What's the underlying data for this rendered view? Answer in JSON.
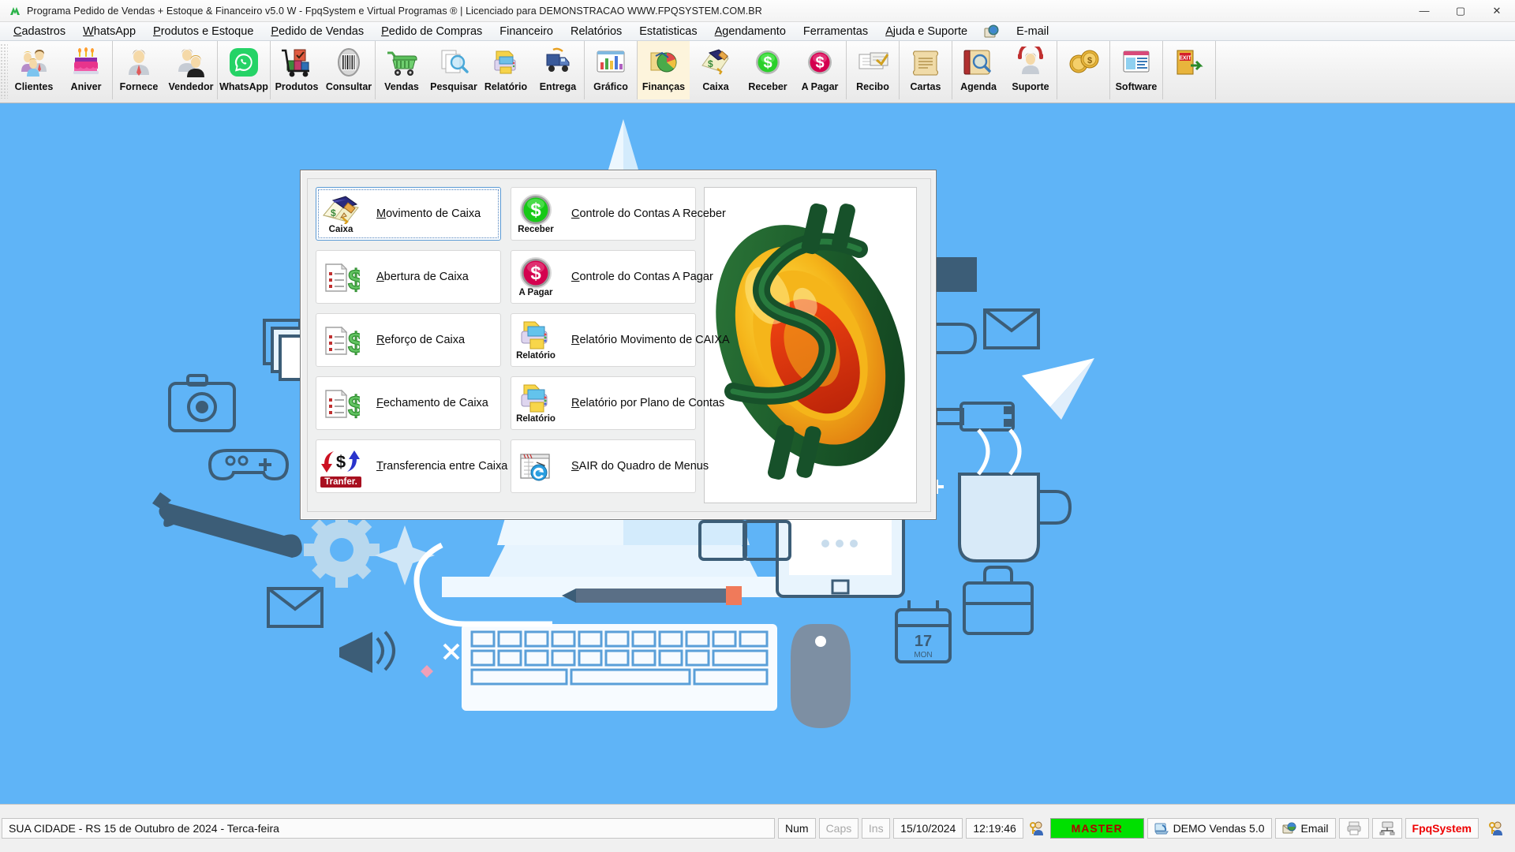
{
  "window": {
    "title": "Programa Pedido de Vendas + Estoque & Financeiro v5.0 W - FpqSystem e Virtual Programas ® | Licenciado para  DEMONSTRACAO WWW.FPQSYSTEM.COM.BR",
    "app_icon": "app-logo-icon",
    "minimize": "—",
    "maximize": "▢",
    "close": "✕"
  },
  "menubar": {
    "items": [
      {
        "label": "Cadastros",
        "accel": "C"
      },
      {
        "label": "WhatsApp",
        "accel": "W"
      },
      {
        "label": "Produtos e Estoque",
        "accel": "P"
      },
      {
        "label": "Pedido de Vendas",
        "accel": "P"
      },
      {
        "label": "Pedido de Compras",
        "accel": "P"
      },
      {
        "label": "Financeiro",
        "accel": ""
      },
      {
        "label": "Relatórios",
        "accel": ""
      },
      {
        "label": "Estatisticas",
        "accel": ""
      },
      {
        "label": "Agendamento",
        "accel": "A"
      },
      {
        "label": "Ferramentas",
        "accel": ""
      },
      {
        "label": "Ajuda e Suporte",
        "accel": "A"
      },
      {
        "label": "E-mail",
        "accel": ""
      }
    ],
    "globe_icon": "globe-icon"
  },
  "toolbar": {
    "groups": [
      {
        "buttons": [
          {
            "label": "Clientes",
            "icon": "clients-icon"
          },
          {
            "label": "Aniver",
            "icon": "birthday-cake-icon"
          }
        ]
      },
      {
        "buttons": [
          {
            "label": "Fornece",
            "icon": "supplier-person-icon"
          },
          {
            "label": "Vendedor",
            "icon": "salesperson-icon"
          }
        ]
      },
      {
        "buttons": [
          {
            "label": "WhatsApp",
            "icon": "whatsapp-icon"
          }
        ]
      },
      {
        "buttons": [
          {
            "label": "Produtos",
            "icon": "products-cart-icon"
          },
          {
            "label": "Consultar",
            "icon": "barcode-icon"
          }
        ]
      },
      {
        "buttons": [
          {
            "label": "Vendas",
            "icon": "shopping-cart-icon"
          },
          {
            "label": "Pesquisar",
            "icon": "search-documents-icon"
          },
          {
            "label": "Relatório",
            "icon": "report-printer-icon"
          },
          {
            "label": "Entrega",
            "icon": "delivery-truck-icon"
          }
        ]
      },
      {
        "buttons": [
          {
            "label": "Gráfico",
            "icon": "bar-chart-icon"
          }
        ]
      },
      {
        "buttons": [
          {
            "label": "Finanças",
            "icon": "finance-pie-icon",
            "selected": true
          },
          {
            "label": "Caixa",
            "icon": "cash-book-icon"
          },
          {
            "label": "Receber",
            "icon": "receive-money-icon"
          },
          {
            "label": "A Pagar",
            "icon": "pay-money-icon"
          }
        ]
      },
      {
        "buttons": [
          {
            "label": "Recibo",
            "icon": "receipt-icon"
          }
        ]
      },
      {
        "buttons": [
          {
            "label": "Cartas",
            "icon": "letters-scroll-icon"
          }
        ]
      },
      {
        "buttons": [
          {
            "label": "Agenda",
            "icon": "agenda-search-icon"
          },
          {
            "label": "Suporte",
            "icon": "support-person-icon"
          }
        ]
      },
      {
        "buttons": [
          {
            "label": "",
            "icon": "money-coins-icon"
          }
        ]
      },
      {
        "buttons": [
          {
            "label": "Software",
            "icon": "software-window-icon"
          }
        ]
      },
      {
        "buttons": [
          {
            "label": "",
            "icon": "exit-door-icon"
          }
        ]
      }
    ]
  },
  "dialog": {
    "left_buttons": [
      {
        "label": "Movimento de Caixa",
        "accel": "M",
        "sub": "Caixa",
        "icon": "cash-book-icon",
        "focused": true
      },
      {
        "label": "Abertura de Caixa",
        "accel": "A",
        "sub": "",
        "icon": "open-cash-icon",
        "focused": false
      },
      {
        "label": "Reforço de Caixa",
        "accel": "R",
        "sub": "",
        "icon": "reinforce-cash-icon",
        "focused": false
      },
      {
        "label": "Fechamento de Caixa",
        "accel": "F",
        "sub": "",
        "icon": "close-cash-icon",
        "focused": false
      },
      {
        "label": "Transferencia entre Caixa",
        "accel": "T",
        "sub": "Tranfer.",
        "icon": "transfer-icon",
        "focused": false
      }
    ],
    "right_buttons": [
      {
        "label": "Controle do Contas A Receber",
        "accel": "C",
        "sub": "Receber",
        "icon": "receive-money-icon",
        "focused": false
      },
      {
        "label": "Controle do Contas A Pagar",
        "accel": "C",
        "sub": "A Pagar",
        "icon": "pay-money-icon",
        "focused": false
      },
      {
        "label": "Relatório Movimento de CAIXA",
        "accel": "R",
        "sub": "Relatório",
        "icon": "report-printer-icon",
        "focused": false
      },
      {
        "label": "Relatório por Plano de Contas",
        "accel": "R",
        "sub": "Relatório",
        "icon": "report-printer-icon",
        "focused": false
      },
      {
        "label": "SAIR do Quadro de Menus",
        "accel": "S",
        "sub": "",
        "icon": "exit-back-icon",
        "focused": false
      }
    ],
    "artwork": "dollar-sign-sphere-graphic"
  },
  "statusbar": {
    "message": "SUA CIDADE - RS 15 de Outubro de 2024 - Terca-feira",
    "num": "Num",
    "caps": "Caps",
    "ins": "Ins",
    "date": "15/10/2024",
    "time": "12:19:46",
    "user_icon": "user-key-icon",
    "user_level": "MASTER",
    "version_icon": "computer-icon",
    "version": "DEMO Vendas 5.0",
    "email_icon": "email-globe-icon",
    "email": "Email",
    "printer_icon": "printer-icon",
    "network_icon": "network-icon",
    "brand": "FpqSystem",
    "brand_icon": "user-key-icon"
  },
  "colors": {
    "desktop": "#5fb4f7",
    "wallpaper_ink": "#3c5d77",
    "accent_green": "#00e000",
    "brand_red": "#ee0000",
    "focus_blue": "#5b9bd5"
  }
}
